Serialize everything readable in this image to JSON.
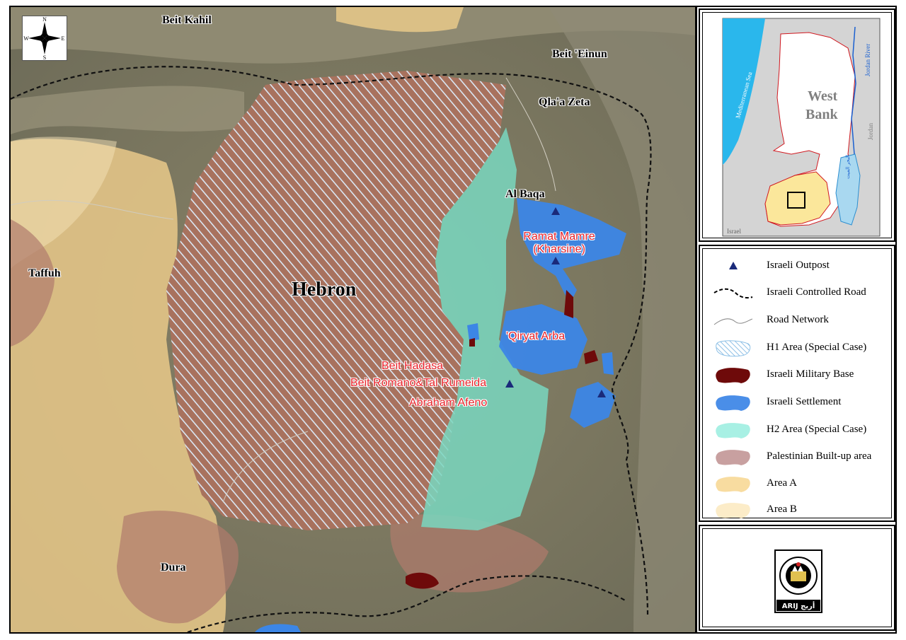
{
  "map": {
    "places": {
      "beit_kahil": "Beit Kahil",
      "beit_einun": "Beit 'Einun",
      "qlaa_zeta": "Qla'a Zeta",
      "al_baqa": "Al Baqa",
      "taffuh": "Taffuh",
      "hebron": "Hebron",
      "dura": "Dura"
    },
    "settlements": {
      "ramat_mamre_1": "Ramat Mamre",
      "ramat_mamre_2": "(Kharsine)",
      "qiryat_arba": "'Qiryat Arba",
      "beit_hadasa": "Beit Hadasa",
      "beit_romano": "Beit Romano&Tal Rumeida",
      "abraham_afeno": "Abraham Afeno"
    },
    "compass": {
      "n": "N",
      "s": "S",
      "e": "E",
      "w": "W"
    }
  },
  "inset": {
    "sea": "Mediterranean Sea",
    "river": "Jordan River",
    "region_line1": "West",
    "region_line2": "Bank",
    "jordan": "Jordan",
    "israel": "Israel",
    "dead_sea": "البحر الميت"
  },
  "legend": {
    "items": [
      {
        "label": "Israeli Outpost",
        "symbol": "triangle",
        "color": "#1a2a7a"
      },
      {
        "label": "Israeli Controlled Road",
        "symbol": "dashed-line",
        "color": "#000000"
      },
      {
        "label": "Road Network",
        "symbol": "thin-line",
        "color": "#888888"
      },
      {
        "label": "H1 Area (Special Case)",
        "symbol": "hatched",
        "color": "#a8cce8"
      },
      {
        "label": "Israeli Military Base",
        "symbol": "blob",
        "color": "#6e0a0a"
      },
      {
        "label": "Israeli Settlement",
        "symbol": "blob",
        "color": "#4a8ee8"
      },
      {
        "label": "H2 Area (Special Case)",
        "symbol": "blob",
        "color": "#a8f0e4"
      },
      {
        "label": "Palestinian Built-up area",
        "symbol": "blob",
        "color": "#c8a0a0"
      },
      {
        "label": "Area A",
        "symbol": "blob",
        "color": "#f8dca0"
      },
      {
        "label": "Area B",
        "symbol": "blob",
        "color": "#fcecc8"
      }
    ]
  },
  "logo": {
    "text": "ARIJ أريج"
  }
}
